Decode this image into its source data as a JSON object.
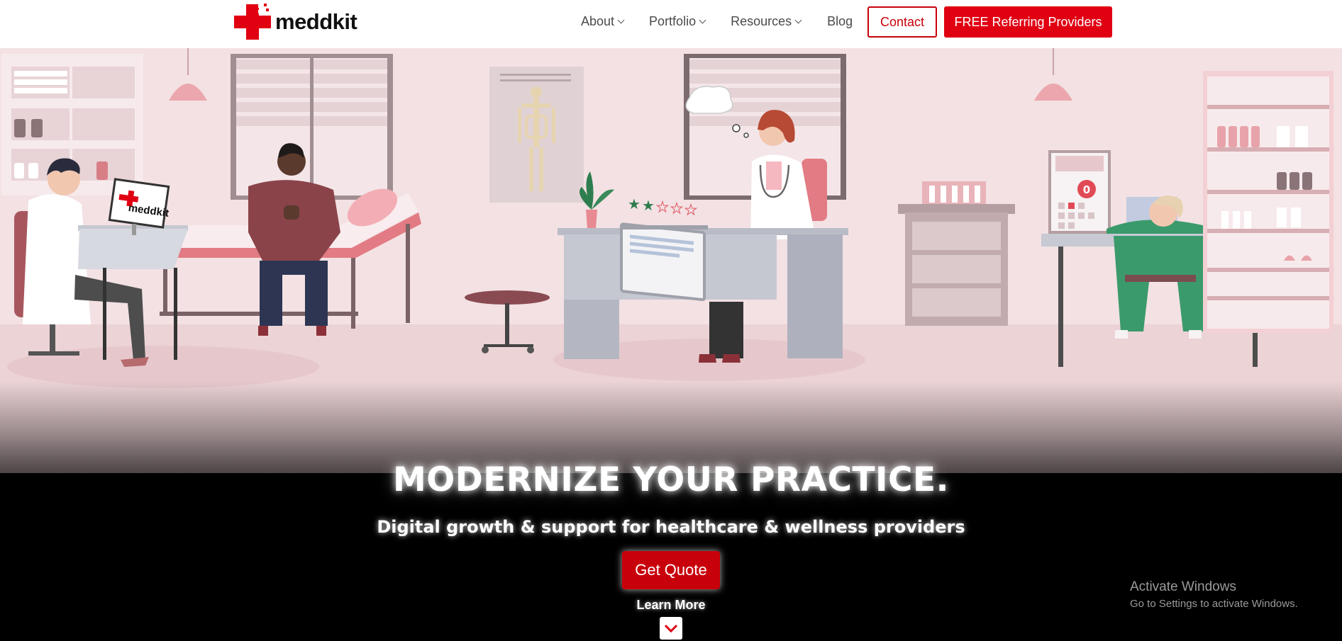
{
  "brand": {
    "name": "meddkit",
    "color": "#e00012"
  },
  "nav": {
    "about": "About",
    "portfolio": "Portfolio",
    "resources": "Resources",
    "blog": "Blog",
    "contact": "Contact",
    "cta": "FREE Referring Providers"
  },
  "hero": {
    "headline": "MODERNIZE YOUR PRACTICE.",
    "subheadline": "Digital growth & support for healthcare & wellness providers",
    "quote_button": "Get Quote",
    "learn_more": "Learn More"
  },
  "illustration": {
    "monitor_logo": "meddkit",
    "calendar_badge": "0",
    "review_stars_filled": 2,
    "review_stars_total": 5
  },
  "os_overlay": {
    "title": "Activate Windows",
    "subtitle": "Go to Settings to activate Windows."
  },
  "colors": {
    "accent_red": "#e00012",
    "contact_red": "#c8000b",
    "scene_pink": "#f3e1e3",
    "hero_bg": "#000000"
  }
}
